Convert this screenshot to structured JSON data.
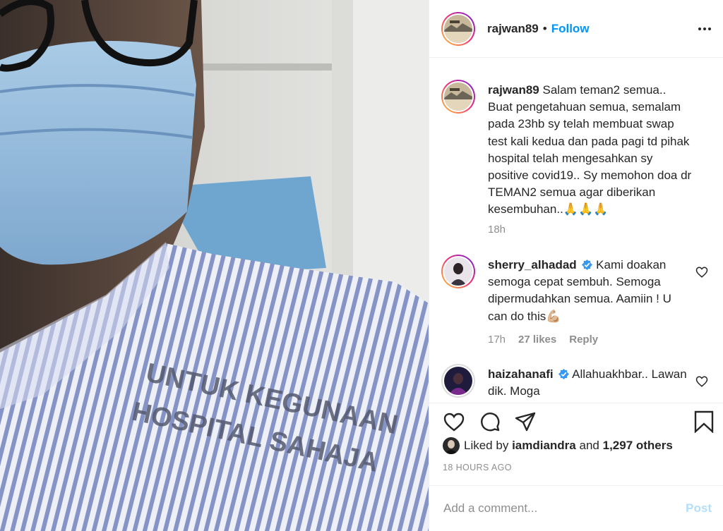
{
  "post": {
    "author": "rajwan89",
    "follow_label": "Follow",
    "separator": "•",
    "more_icon": "more-horizontal-icon"
  },
  "caption": {
    "username": "rajwan89",
    "text": "Salam teman2 semua.. Buat pengetahuan semua, semalam pada 23hb sy telah membuat swap test kali kedua dan pada pagi td pihak hospital telah mengesahkan sy positive covid19.. Sy memohon doa dr TEMAN2 semua agar diberikan kesembuhan..🙏🙏🙏",
    "time": "18h"
  },
  "comments": [
    {
      "username": "sherry_alhadad",
      "verified": true,
      "text": "Kami doakan semoga cepat sembuh. Semoga dipermudahkan semua. Aamiin ! U can do this💪🏼",
      "time": "17h",
      "likes": "27 likes",
      "reply_label": "Reply"
    },
    {
      "username": "haizahanafi",
      "verified": true,
      "text": "Allahuakhbar.. Lawan dik. Moga"
    }
  ],
  "actions": {
    "like_icon": "heart-icon",
    "comment_icon": "comment-icon",
    "share_icon": "paper-plane-icon",
    "save_icon": "bookmark-icon"
  },
  "likes_summary": {
    "prefix": "Liked by",
    "liker": "iamdiandra",
    "joiner": "and",
    "others": "1,297 others"
  },
  "timestamp": "18 HOURS AGO",
  "add_comment": {
    "placeholder": "Add a comment...",
    "post_label": "Post"
  },
  "photo": {
    "gown_text_line1": "UNTUK KEGUNAAN",
    "gown_text_line2": "HOSPITAL SAHAJA"
  },
  "colors": {
    "accent": "#0095f6",
    "post_disabled": "#b2dffc",
    "muted": "#8e8e8e",
    "text": "#262626",
    "verified": "#3897f0"
  }
}
